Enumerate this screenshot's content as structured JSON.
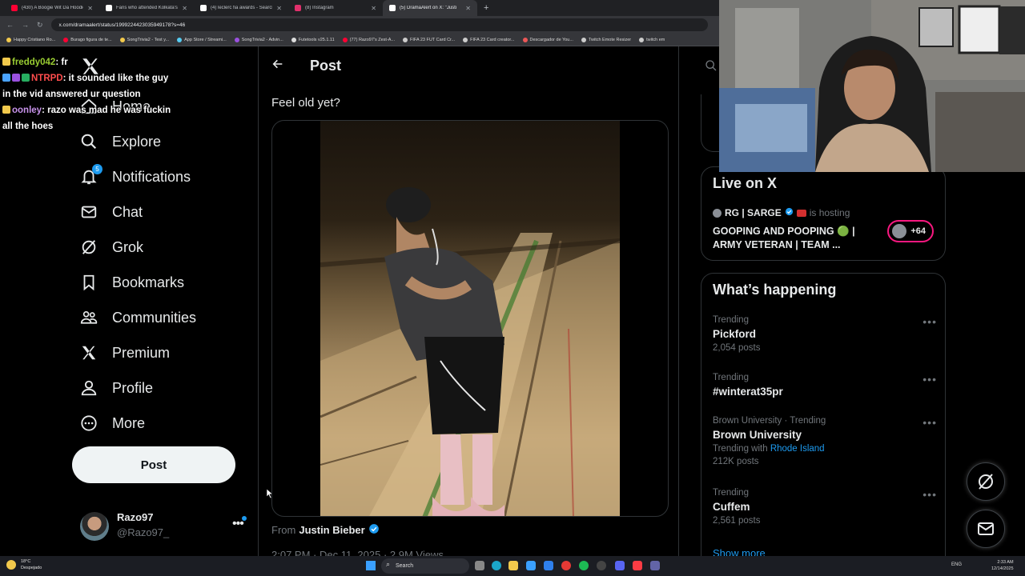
{
  "browser": {
    "tabs": [
      {
        "label": "(430) A Boogie Wit Da Hoodie",
        "icon_color": "#ff0033",
        "active": false
      },
      {
        "label": "Fans who attended Kolkata's S",
        "icon_color": "#ffffff",
        "active": false
      },
      {
        "label": "(4) leclerc fia awards - Search /",
        "icon_color": "#ffffff",
        "active": false
      },
      {
        "label": "(8) Instagram",
        "icon_color": "#e1306c",
        "active": false
      },
      {
        "label": "(5) DramaAlert on X: \"Justi",
        "icon_color": "#ffffff",
        "active": true
      }
    ],
    "url": "x.com/dramaalert/status/1999224423035949178?s=46",
    "bookmarks": [
      {
        "label": "Happy Cristiano Ro...",
        "color": "#f2c94c"
      },
      {
        "label": "Burago figura de te...",
        "color": "#ff0033"
      },
      {
        "label": "SongTrivia2 - Test y...",
        "color": "#f2c94c"
      },
      {
        "label": "App Store / Streami...",
        "color": "#56ccf2"
      },
      {
        "label": "SongTrivia2 - Advin...",
        "color": "#9b51e0"
      },
      {
        "label": "Futetools v25.1.11",
        "color": "#dddddd"
      },
      {
        "label": "(77) Razo97's Zest-A...",
        "color": "#ff0033"
      },
      {
        "label": "FIFA 23 FUT Card Cr...",
        "color": "#cccccc"
      },
      {
        "label": "FIFA 23 Card creator...",
        "color": "#cccccc"
      },
      {
        "label": "Descargador de You...",
        "color": "#eb5757"
      },
      {
        "label": "Twitch Emote Resizer",
        "color": "#cccccc"
      },
      {
        "label": "twitch em",
        "color": "#cccccc"
      }
    ]
  },
  "chat": [
    {
      "user": "freddy042",
      "user_color": "#9acd32",
      "text": ": fr",
      "badge_color": "#f2c94c"
    },
    {
      "user": "NTRPD",
      "user_color": "#ff4d4d",
      "text": ": it sounded like the guy in the vid answered ur question",
      "badge_color": "#4aa3ff"
    },
    {
      "user": "oonley",
      "user_color": "#c792ea",
      "text": ": razo was mad he was fuckin all the hoes",
      "badge_color": "#f2c94c"
    }
  ],
  "nav": {
    "home": "Home",
    "explore": "Explore",
    "notifications": "Notifications",
    "notifications_badge": "5",
    "chat": "Chat",
    "grok": "Grok",
    "bookmarks": "Bookmarks",
    "communities": "Communities",
    "premium": "Premium",
    "profile": "Profile",
    "more": "More",
    "post_button": "Post"
  },
  "account": {
    "name": "Razo97",
    "handle": "@Razo97_"
  },
  "post": {
    "header": "Post",
    "text": "Feel old yet?",
    "from_prefix": "From",
    "from_name": "Justin Bieber",
    "meta": "2:07 PM · Dec 11, 2025 · 2.9M Views"
  },
  "live": {
    "title": "Live on X",
    "host": "RG | SARGE",
    "host_suffix": "is hosting",
    "stream_title": "GOOPING AND POOPING 🟢 | ARMY VETERAN | TEAM ...",
    "viewer_extra": "+64"
  },
  "happening": {
    "title": "What’s happening",
    "trends": [
      {
        "context": "Trending",
        "name": "Pickford",
        "count": "2,054 posts"
      },
      {
        "context": "Trending",
        "name": "#winterat35pr",
        "count": ""
      },
      {
        "context": "Brown University · Trending",
        "name": "Brown University",
        "with_label": "Trending with",
        "with_link": "Rhode Island",
        "count": "212K posts"
      },
      {
        "context": "Trending",
        "name": "Cuffem",
        "count": "2,561 posts"
      }
    ],
    "show_more": "Show more"
  },
  "taskbar": {
    "weather_temp": "18°C",
    "weather_desc": "Despejado",
    "search": "Search",
    "lang": "ENG",
    "time": "2:33 AM",
    "date": "12/14/2025"
  },
  "colors": {
    "accent": "#1d9bf0",
    "live_ring": "#f91880",
    "background": "#000000"
  }
}
